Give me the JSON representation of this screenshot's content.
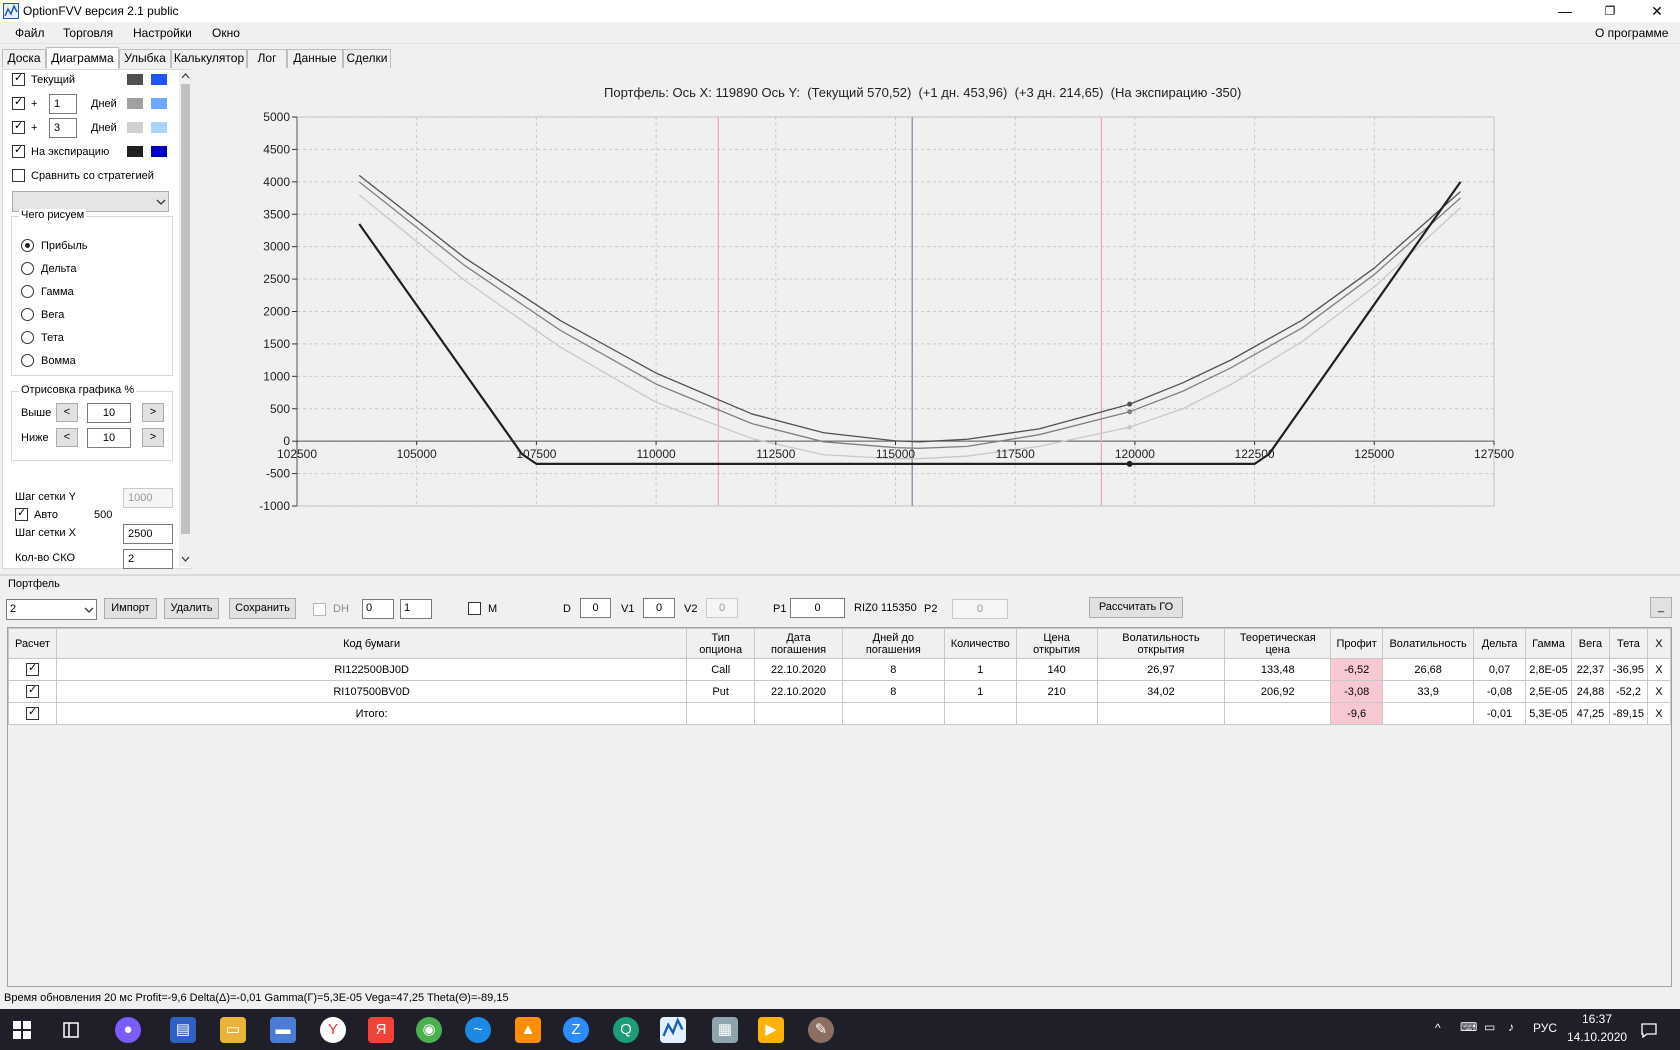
{
  "window": {
    "title": "OptionFVV версия 2.1 public",
    "minimize": "—",
    "restore": "❐",
    "close": "✕"
  },
  "menu": {
    "items": [
      "Файл",
      "Торговля",
      "Настройки",
      "Окно"
    ],
    "about": "О программе"
  },
  "tabs": [
    "Доска",
    "Диаграмма",
    "Улыбка",
    "Калькулятор",
    "Лог",
    "Данные",
    "Сделки"
  ],
  "active_tab": "Диаграмма",
  "left_panel": {
    "current_label": "Текущий",
    "plus_label": "+",
    "days_label": "Дней",
    "days1": "1",
    "days3": "3",
    "expiry_label": "На экспирацию",
    "compare_label": "Сравнить со стратегией",
    "draw_group": "Чего рисуем",
    "radios": [
      "Прибыль",
      "Дельта",
      "Гамма",
      "Вега",
      "Тета",
      "Вомма"
    ],
    "render_group": "Отрисовка графика %",
    "above_label": "Выше",
    "below_label": "Ниже",
    "above_value": "10",
    "below_value": "10",
    "prev_btn": "<",
    "next_btn": ">",
    "grid_y_label": "Шаг сетки Y",
    "grid_y_value": "1000",
    "auto_label": "Авто",
    "auto_value": "500",
    "grid_x_label": "Шаг сетки X",
    "grid_x_value": "2500",
    "sko_label": "Кол-во СКО",
    "sko_value": "2",
    "colors": {
      "current": [
        "#505050",
        "#2255ff"
      ],
      "plus1": [
        "#a0a0a0",
        "#6fa8ff"
      ],
      "plus3": [
        "#d0d0d0",
        "#aad4ff"
      ],
      "expiry": [
        "#202020",
        "#0000cc"
      ]
    }
  },
  "chart_title": "Портфель: Ось X: 119890 Ось Y:  (Текущий 570,52)  (+1 дн. 453,96)  (+3 дн. 214,65)  (На экспирацию -350)",
  "chart_data": {
    "type": "line",
    "title": "Портфель: Ось X: 119890 Ось Y:  (Текущий 570,52)  (+1 дн. 453,96)  (+3 дн. 214,65)  (На экспирацию -350)",
    "xlim": [
      102500,
      127500
    ],
    "ylim": [
      -1000,
      5000
    ],
    "x_ticks": [
      "102500",
      "105000",
      "107500",
      "110000",
      "112500",
      "115000",
      "117500",
      "120000",
      "122500",
      "125000",
      "127500"
    ],
    "y_ticks": [
      "5000",
      "4500",
      "4000",
      "3500",
      "3000",
      "2500",
      "2000",
      "1500",
      "1000",
      "500",
      "0",
      "-500",
      "-1000"
    ],
    "grid": true,
    "vlines": {
      "center": 115350,
      "sko_left": 111300,
      "sko_right": 119300
    },
    "marker_x": 119890,
    "series": [
      {
        "color": "#505050",
        "x": [
          103800,
          106000,
          108000,
          110000,
          112000,
          113500,
          115000,
          115500,
          116500,
          118000,
          119890,
          121000,
          122000,
          123500,
          125000,
          126800
        ],
        "y": [
          4100,
          2830,
          1860,
          1050,
          420,
          130,
          5,
          -10,
          30,
          190,
          570,
          900,
          1250,
          1870,
          2670,
          3850
        ]
      },
      {
        "color": "#808080",
        "x": [
          103800,
          106000,
          108000,
          110000,
          112000,
          113500,
          115000,
          115500,
          116500,
          118000,
          119890,
          121000,
          122000,
          123500,
          125000,
          126800
        ],
        "y": [
          4000,
          2710,
          1710,
          880,
          270,
          -10,
          -100,
          -110,
          -80,
          100,
          454,
          770,
          1130,
          1750,
          2570,
          3750
        ]
      },
      {
        "color": "#c8c8c8",
        "x": [
          103800,
          106000,
          108000,
          110000,
          112000,
          113500,
          115000,
          115500,
          116500,
          118000,
          119890,
          121000,
          122000,
          123500,
          125000,
          126800
        ],
        "y": [
          3800,
          2480,
          1450,
          600,
          40,
          -210,
          -270,
          -270,
          -230,
          -80,
          215,
          500,
          870,
          1540,
          2380,
          3600
        ]
      },
      {
        "color": "#202020",
        "x": [
          103800,
          107200,
          107500,
          122500,
          122800,
          126800
        ],
        "y": [
          3350,
          -200,
          -350,
          -350,
          -200,
          4000
        ]
      }
    ]
  },
  "portfolio": {
    "label": "Портфель",
    "select_value": "2",
    "import_btn": "Импорт",
    "delete_btn": "Удалить",
    "save_btn": "Сохранить",
    "dh_label": "DH",
    "spin1": "0",
    "spin2": "1",
    "m_label": "M",
    "d_label": "D",
    "d_value": "0",
    "v1_label": "V1",
    "v1_value": "0",
    "v2_label": "V2",
    "v2_value": "0",
    "p1_label": "P1",
    "p1_value": "0",
    "riz_label": "RIZ0 115350",
    "p2_label": "P2",
    "p2_value": "0",
    "calc_go_btn": "Рассчитать ГО",
    "min_btn": "_"
  },
  "table": {
    "headers": [
      "Расчет",
      "Код бумаги",
      "Тип\nопциона",
      "Дата\nпогашения",
      "Дней до\nпогашения",
      "Количество",
      "Цена\nоткрытия",
      "Волатильность\nоткрытия",
      "Теоретическая\nцена",
      "Профит",
      "Волатильность",
      "Дельта",
      "Гамма",
      "Вега",
      "Тета",
      "X"
    ],
    "rows": [
      {
        "code": "RI122500BJ0D",
        "type": "Call",
        "date": "22.10.2020",
        "days": "8",
        "qty": "1",
        "price": "140",
        "vol_open": "26,97",
        "theo": "133,48",
        "profit": "-6,52",
        "vol": "26,68",
        "delta": "0,07",
        "gamma": "2,8E-05",
        "vega": "22,37",
        "theta": "-36,95",
        "x": "X"
      },
      {
        "code": "RI107500BV0D",
        "type": "Put",
        "date": "22.10.2020",
        "days": "8",
        "qty": "1",
        "price": "210",
        "vol_open": "34,02",
        "theo": "206,92",
        "profit": "-3,08",
        "vol": "33,9",
        "delta": "-0,08",
        "gamma": "2,5E-05",
        "vega": "24,88",
        "theta": "-52,2",
        "x": "X"
      },
      {
        "code": "Итого:",
        "type": "",
        "date": "",
        "days": "",
        "qty": "",
        "price": "",
        "vol_open": "",
        "theo": "",
        "profit": "-9,6",
        "vol": "",
        "delta": "-0,01",
        "gamma": "5,3E-05",
        "vega": "47,25",
        "theta": "-89,15",
        "x": "X"
      }
    ]
  },
  "status": "Время обновления 20 мс   Profit=-9,6 Delta(Δ)=-0,01 Gamma(Γ)=5,3E-05 Vega=47,25 Theta(Θ)=-89,15",
  "taskbar": {
    "lang": "РУС",
    "time": "16:37",
    "date": "14.10.2020"
  }
}
